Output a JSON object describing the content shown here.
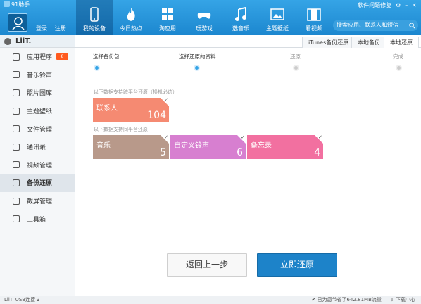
{
  "app": {
    "title": "91助手"
  },
  "auth": {
    "login": "登录",
    "divider": "|",
    "register": "注册"
  },
  "nav": [
    {
      "label": "我的设备",
      "icon": "phone-icon"
    },
    {
      "label": "今日热点",
      "icon": "flame-icon"
    },
    {
      "label": "淘应用",
      "icon": "apps-grid-icon"
    },
    {
      "label": "玩游戏",
      "icon": "gamepad-icon"
    },
    {
      "label": "选音乐",
      "icon": "music-note-icon"
    },
    {
      "label": "主题壁纸",
      "icon": "image-icon"
    },
    {
      "label": "看视频",
      "icon": "film-icon"
    }
  ],
  "util": {
    "feedback": "软件问题修复"
  },
  "search": {
    "placeholder": "搜索应用、联系人和短信"
  },
  "device": {
    "name": "LiiT."
  },
  "sidebar": {
    "items": [
      {
        "label": "应用程序",
        "badge": "8"
      },
      {
        "label": "音乐铃声"
      },
      {
        "label": "照片图库"
      },
      {
        "label": "主题壁纸"
      },
      {
        "label": "文件管理"
      },
      {
        "label": "通讯录"
      },
      {
        "label": "视频管理"
      },
      {
        "label": "备份还原"
      },
      {
        "label": "截屏管理"
      },
      {
        "label": "工具箱"
      }
    ]
  },
  "tabs": [
    {
      "label": "iTunes备份还原"
    },
    {
      "label": "本地备份"
    },
    {
      "label": "本地还原"
    }
  ],
  "steps": [
    {
      "label": "选择备份包"
    },
    {
      "label": "选择还原的资料"
    },
    {
      "label": "还原"
    },
    {
      "label": "完成"
    }
  ],
  "sections": {
    "cross_platform": "以下数据支持跨平台还原（换机必选）",
    "same_platform": "以下数据支持同平台还原"
  },
  "tiles": [
    {
      "label": "联系人",
      "count": "104",
      "color": "#f58a72"
    },
    {
      "label": "音乐",
      "count": "5",
      "color": "#b8998a"
    },
    {
      "label": "自定义铃声",
      "count": "6",
      "color": "#d77fd0"
    },
    {
      "label": "备忘录",
      "count": "4",
      "color": "#f270a0"
    }
  ],
  "buttons": {
    "back": "返回上一步",
    "restore": "立即还原"
  },
  "status": {
    "device": "LiiT.",
    "connection": "USB连接",
    "saved": "已为您节省了642.81MB流量",
    "downloads": "下载中心"
  }
}
